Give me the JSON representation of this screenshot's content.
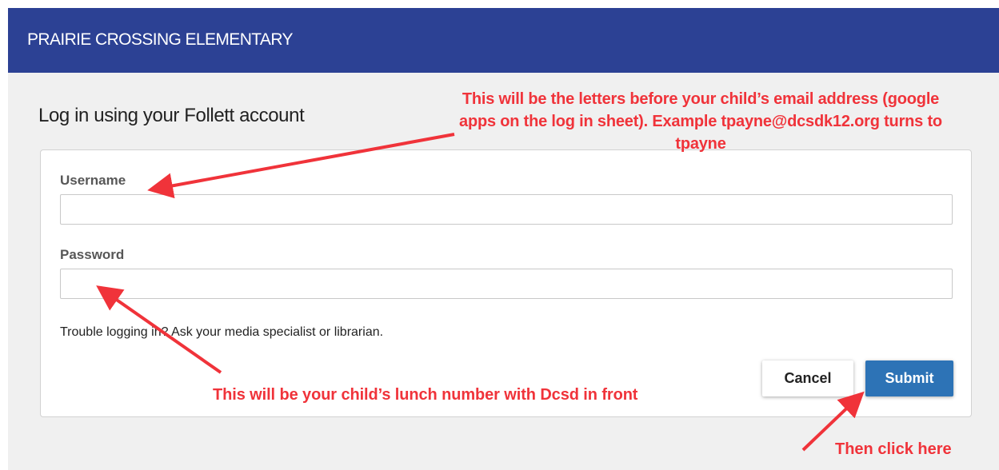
{
  "header": {
    "title": "PRAIRIE CROSSING ELEMENTARY"
  },
  "login": {
    "heading": "Log in using your Follett account",
    "username_label": "Username",
    "username_value": "",
    "password_label": "Password",
    "password_value": "",
    "help_text": "Trouble logging in? Ask your media specialist or librarian.",
    "cancel_label": "Cancel",
    "submit_label": "Submit"
  },
  "annotations": {
    "username_note": "This will be the letters before your child’s email address (google apps on the log in sheet). Example tpayne@dcsdk12.org turns to tpayne",
    "password_note": "This will be your child’s lunch number with Dcsd in front",
    "submit_note": "Then click here"
  },
  "colors": {
    "header_bg": "#2c4194",
    "submit_bg": "#2d73b6",
    "annotation": "#f0333a",
    "page_bg": "#f0f0f0"
  }
}
